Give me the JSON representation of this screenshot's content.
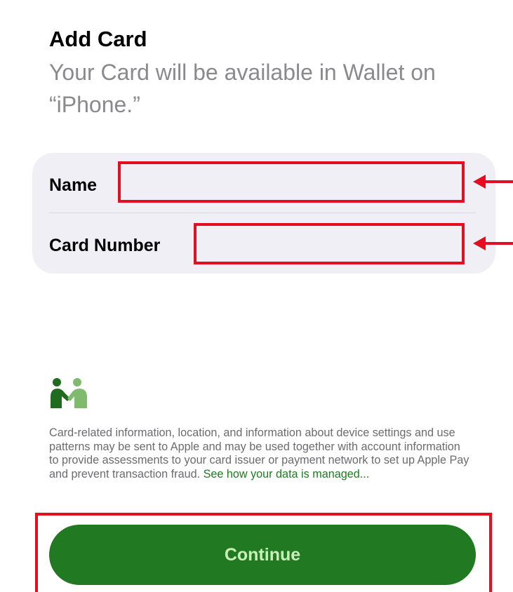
{
  "header": {
    "title": "Add Card",
    "subtitle": "Your Card will be available in Wallet on “iPhone.”"
  },
  "form": {
    "name_label": "Name",
    "name_value": "",
    "card_number_label": "Card Number",
    "card_number_value": ""
  },
  "privacy": {
    "icon": "people-icon",
    "text": "Card-related information, location, and information about device settings and use patterns may be sent to Apple and may be used together with account information to provide assessments to your card issuer or payment network to set up Apple Pay and prevent transaction fraud.",
    "link": "See how your data is managed..."
  },
  "actions": {
    "continue_label": "Continue"
  },
  "colors": {
    "accent": "#217a21",
    "highlight": "#e30f20",
    "button_text": "#c9f0b8"
  }
}
